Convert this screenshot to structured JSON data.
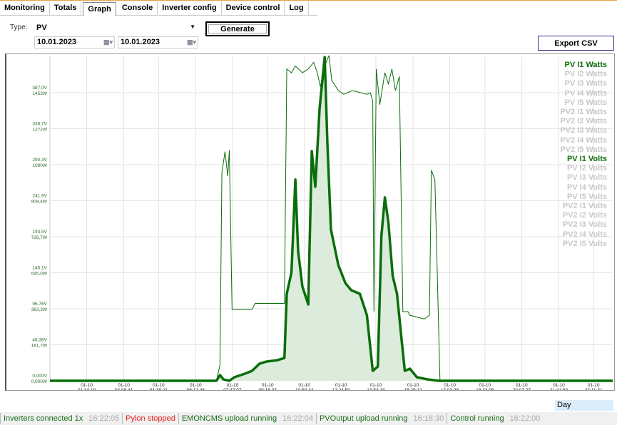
{
  "tabs": [
    "Monitoring",
    "Totals",
    "Graph",
    "Console",
    "Inverter config",
    "Device control",
    "Log"
  ],
  "active_tab": 2,
  "controls": {
    "type_label": "Type:",
    "type_value": "PV",
    "date_from": "10.01.2023",
    "date_to": "10.01.2023",
    "generate": "Generate",
    "export": "Export CSV",
    "period": "Day"
  },
  "legend": [
    {
      "label": "PV I1 Watts",
      "active": true
    },
    {
      "label": "PV I2 Watts",
      "active": false
    },
    {
      "label": "PV I3 Watts",
      "active": false
    },
    {
      "label": "PV I4 Watts",
      "active": false
    },
    {
      "label": "PV I5 Watts",
      "active": false
    },
    {
      "label": "PV2 I1 Watts",
      "active": false
    },
    {
      "label": "PV2 I2 Watts",
      "active": false
    },
    {
      "label": "PV2 I3 Watts",
      "active": false
    },
    {
      "label": "PV2 I4 Watts",
      "active": false
    },
    {
      "label": "PV2 I5 Watts",
      "active": false
    },
    {
      "label": "PV I1 Volts",
      "active": true
    },
    {
      "label": "PV I2 Volts",
      "active": false
    },
    {
      "label": "PV I3 Volts",
      "active": false
    },
    {
      "label": "PV I4 Volts",
      "active": false
    },
    {
      "label": "PV I5 Volts",
      "active": false
    },
    {
      "label": "PV2 I1 Volts",
      "active": false
    },
    {
      "label": "PV2 I2 Volts",
      "active": false
    },
    {
      "label": "PV2 I3 Volts",
      "active": false
    },
    {
      "label": "PV2 I4 Volts",
      "active": false
    },
    {
      "label": "PV2 I5 Volts",
      "active": false
    }
  ],
  "colors": {
    "series": "#0a6e0a",
    "fill": "#dcebdc",
    "inactive": "#c8c8c8",
    "grid": "#e4e4e4",
    "stopped": "#e52020",
    "running": "#1a6e1a"
  },
  "chart_data": {
    "type": "line",
    "x_unit": "minutes since 00:00",
    "xlim": [
      0,
      1440
    ],
    "ylim_watts": [
      0,
      1637
    ],
    "ylim_volts": [
      0,
      436
    ],
    "y_ticks": [
      {
        "v": "0,000V",
        "w": "0,000W"
      },
      {
        "v": "48,38V",
        "w": "181,7W"
      },
      {
        "v": "96,76V",
        "w": "363,3W"
      },
      {
        "v": "145,1V",
        "w": "545,0W"
      },
      {
        "v": "193,5V",
        "w": "726,7W"
      },
      {
        "v": "241,9V",
        "w": "908,4W"
      },
      {
        "v": "290,3V",
        "w": "1090W"
      },
      {
        "v": "338,7V",
        "w": "1272W"
      },
      {
        "v": "387,0V",
        "w": "1453W"
      }
    ],
    "x_ticks": [
      {
        "d": "01-10",
        "t": "01:34:19",
        "m": 94
      },
      {
        "d": "01-10",
        "t": "03:08:41",
        "m": 189
      },
      {
        "d": "01-10",
        "t": "04:38:21",
        "m": 278
      },
      {
        "d": "01-10",
        "t": "06:12:46",
        "m": 373
      },
      {
        "d": "01-10",
        "t": "07:47:07",
        "m": 467
      },
      {
        "d": "01-10",
        "t": "09:16:37",
        "m": 557
      },
      {
        "d": "01-10",
        "t": "10:50:43",
        "m": 651
      },
      {
        "d": "01-10",
        "t": "12:24:50",
        "m": 745
      },
      {
        "d": "01-10",
        "t": "13:54:18",
        "m": 834
      },
      {
        "d": "01-10",
        "t": "15:29:12",
        "m": 929
      },
      {
        "d": "01-10",
        "t": "17:03:28",
        "m": 1023
      },
      {
        "d": "01-10",
        "t": "18:33:06",
        "m": 1113
      },
      {
        "d": "01-10",
        "t": "20:07:27",
        "m": 1207
      },
      {
        "d": "01-10",
        "t": "21:41:50",
        "m": 1302
      },
      {
        "d": "01-10",
        "t": "23:11:31",
        "m": 1391
      }
    ],
    "series": [
      {
        "name": "PV I1 Watts",
        "unit": "W",
        "points": [
          [
            0,
            0
          ],
          [
            426,
            0
          ],
          [
            435,
            29
          ],
          [
            444,
            7
          ],
          [
            459,
            0
          ],
          [
            472,
            18
          ],
          [
            499,
            36
          ],
          [
            517,
            50
          ],
          [
            536,
            86
          ],
          [
            554,
            97
          ],
          [
            582,
            104
          ],
          [
            600,
            115
          ],
          [
            606,
            439
          ],
          [
            618,
            547
          ],
          [
            628,
            1015
          ],
          [
            635,
            655
          ],
          [
            646,
            475
          ],
          [
            661,
            385
          ],
          [
            670,
            1159
          ],
          [
            679,
            979
          ],
          [
            690,
            1374
          ],
          [
            703,
            1633
          ],
          [
            710,
            1195
          ],
          [
            719,
            763
          ],
          [
            738,
            583
          ],
          [
            756,
            493
          ],
          [
            771,
            457
          ],
          [
            793,
            439
          ],
          [
            811,
            331
          ],
          [
            826,
            50
          ],
          [
            839,
            72
          ],
          [
            848,
            727
          ],
          [
            857,
            925
          ],
          [
            866,
            799
          ],
          [
            877,
            529
          ],
          [
            888,
            439
          ],
          [
            899,
            223
          ],
          [
            908,
            50
          ],
          [
            921,
            61
          ],
          [
            939,
            18
          ],
          [
            967,
            7
          ],
          [
            994,
            0
          ],
          [
            1440,
            0
          ]
        ]
      },
      {
        "name": "PV I1 Volts",
        "unit": "V",
        "points": [
          [
            0,
            0
          ],
          [
            426,
            0
          ],
          [
            435,
            21
          ],
          [
            440,
            280
          ],
          [
            448,
            308
          ],
          [
            455,
            275
          ],
          [
            459,
            310
          ],
          [
            466,
            96
          ],
          [
            517,
            96
          ],
          [
            525,
            104
          ],
          [
            600,
            104
          ],
          [
            606,
            419
          ],
          [
            618,
            414
          ],
          [
            628,
            423
          ],
          [
            646,
            414
          ],
          [
            661,
            419
          ],
          [
            675,
            428
          ],
          [
            684,
            414
          ],
          [
            692,
            395
          ],
          [
            703,
            423
          ],
          [
            714,
            437
          ],
          [
            721,
            404
          ],
          [
            738,
            390
          ],
          [
            752,
            385
          ],
          [
            774,
            390
          ],
          [
            811,
            385
          ],
          [
            820,
            387
          ],
          [
            826,
            375
          ],
          [
            829,
            93
          ],
          [
            835,
            419
          ],
          [
            844,
            371
          ],
          [
            857,
            414
          ],
          [
            866,
            399
          ],
          [
            875,
            419
          ],
          [
            884,
            390
          ],
          [
            894,
            409
          ],
          [
            903,
            93
          ],
          [
            916,
            93
          ],
          [
            921,
            88
          ],
          [
            958,
            83
          ],
          [
            971,
            88
          ],
          [
            976,
            283
          ],
          [
            985,
            270
          ],
          [
            998,
            0
          ],
          [
            1440,
            0
          ]
        ]
      }
    ]
  },
  "status": [
    {
      "text": "Inverters connected 1x",
      "time": "16:22:05",
      "state": "running"
    },
    {
      "text": "Pylon stopped",
      "time": "",
      "state": "stopped"
    },
    {
      "text": "EMONCMS upload running",
      "time": "16:22:04",
      "state": "running"
    },
    {
      "text": "PVOutput upload running",
      "time": "16:18:30",
      "state": "running"
    },
    {
      "text": "Control running",
      "time": "16:22:00",
      "state": "running"
    }
  ]
}
